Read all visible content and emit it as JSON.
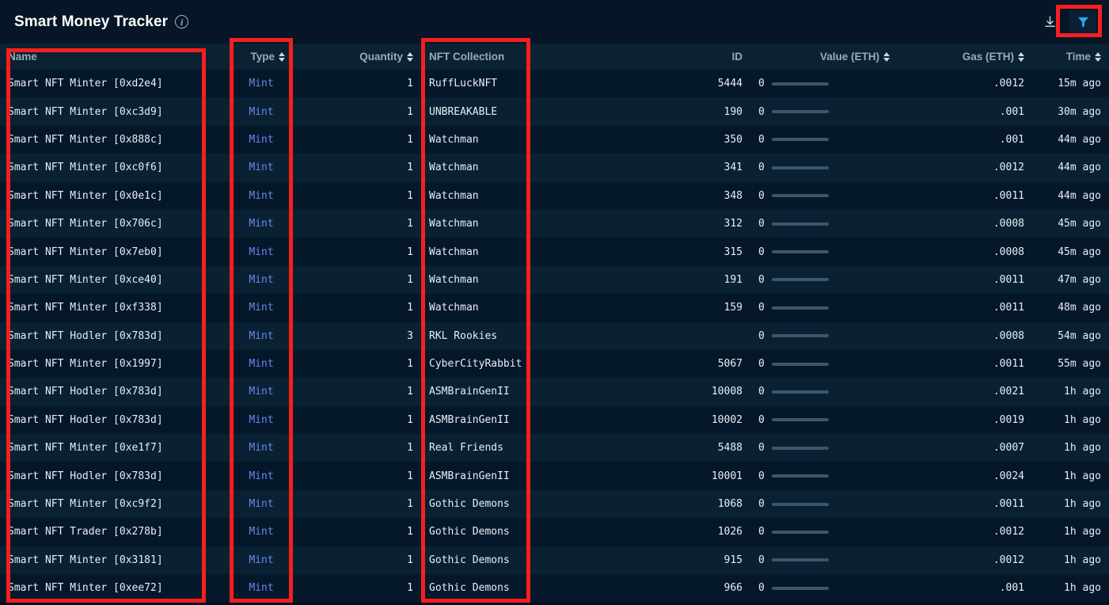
{
  "header": {
    "title": "Smart Money Tracker",
    "info_icon": "info-icon",
    "download_icon": "download-icon",
    "filter_icon": "filter-icon",
    "accent_color": "#2fa8e8",
    "highlight_color": "#f61f1f"
  },
  "table": {
    "columns": [
      {
        "key": "name",
        "label": "Name",
        "align": "left",
        "sortable": false
      },
      {
        "key": "type",
        "label": "Type",
        "align": "right",
        "sortable": true
      },
      {
        "key": "quantity",
        "label": "Quantity",
        "align": "right",
        "sortable": true
      },
      {
        "key": "nft",
        "label": "NFT Collection",
        "align": "left",
        "sortable": false
      },
      {
        "key": "id",
        "label": "ID",
        "align": "right",
        "sortable": false
      },
      {
        "key": "value",
        "label": "Value (ETH)",
        "align": "right",
        "sortable": true
      },
      {
        "key": "gas",
        "label": "Gas (ETH)",
        "align": "right",
        "sortable": true
      },
      {
        "key": "time",
        "label": "Time",
        "align": "right",
        "sortable": true
      }
    ],
    "rows": [
      {
        "name": "Smart NFT Minter [0xd2e4]",
        "type": "Mint",
        "quantity": "1",
        "nft": "RuffLuckNFT",
        "id": "5444",
        "value": "0",
        "gas": ".0012",
        "time": "15m ago"
      },
      {
        "name": "Smart NFT Minter [0xc3d9]",
        "type": "Mint",
        "quantity": "1",
        "nft": "UNBREAKABLE",
        "id": "190",
        "value": "0",
        "gas": ".001",
        "time": "30m ago"
      },
      {
        "name": "Smart NFT Minter [0x888c]",
        "type": "Mint",
        "quantity": "1",
        "nft": "Watchman",
        "id": "350",
        "value": "0",
        "gas": ".001",
        "time": "44m ago"
      },
      {
        "name": "Smart NFT Minter [0xc0f6]",
        "type": "Mint",
        "quantity": "1",
        "nft": "Watchman",
        "id": "341",
        "value": "0",
        "gas": ".0012",
        "time": "44m ago"
      },
      {
        "name": "Smart NFT Minter [0x0e1c]",
        "type": "Mint",
        "quantity": "1",
        "nft": "Watchman",
        "id": "348",
        "value": "0",
        "gas": ".0011",
        "time": "44m ago"
      },
      {
        "name": "Smart NFT Minter [0x706c]",
        "type": "Mint",
        "quantity": "1",
        "nft": "Watchman",
        "id": "312",
        "value": "0",
        "gas": ".0008",
        "time": "45m ago"
      },
      {
        "name": "Smart NFT Minter [0x7eb0]",
        "type": "Mint",
        "quantity": "1",
        "nft": "Watchman",
        "id": "315",
        "value": "0",
        "gas": ".0008",
        "time": "45m ago"
      },
      {
        "name": "Smart NFT Minter [0xce40]",
        "type": "Mint",
        "quantity": "1",
        "nft": "Watchman",
        "id": "191",
        "value": "0",
        "gas": ".0011",
        "time": "47m ago"
      },
      {
        "name": "Smart NFT Minter [0xf338]",
        "type": "Mint",
        "quantity": "1",
        "nft": "Watchman",
        "id": "159",
        "value": "0",
        "gas": ".0011",
        "time": "48m ago"
      },
      {
        "name": "Smart NFT Hodler [0x783d]",
        "type": "Mint",
        "quantity": "3",
        "nft": "RKL Rookies",
        "id": "",
        "value": "0",
        "gas": ".0008",
        "time": "54m ago"
      },
      {
        "name": "Smart NFT Minter [0x1997]",
        "type": "Mint",
        "quantity": "1",
        "nft": "CyberCityRabbit",
        "id": "5067",
        "value": "0",
        "gas": ".0011",
        "time": "55m ago"
      },
      {
        "name": "Smart NFT Hodler [0x783d]",
        "type": "Mint",
        "quantity": "1",
        "nft": "ASMBrainGenII",
        "id": "10008",
        "value": "0",
        "gas": ".0021",
        "time": "1h ago"
      },
      {
        "name": "Smart NFT Hodler [0x783d]",
        "type": "Mint",
        "quantity": "1",
        "nft": "ASMBrainGenII",
        "id": "10002",
        "value": "0",
        "gas": ".0019",
        "time": "1h ago"
      },
      {
        "name": "Smart NFT Minter [0xe1f7]",
        "type": "Mint",
        "quantity": "1",
        "nft": "Real Friends",
        "id": "5488",
        "value": "0",
        "gas": ".0007",
        "time": "1h ago"
      },
      {
        "name": "Smart NFT Hodler [0x783d]",
        "type": "Mint",
        "quantity": "1",
        "nft": "ASMBrainGenII",
        "id": "10001",
        "value": "0",
        "gas": ".0024",
        "time": "1h ago"
      },
      {
        "name": "Smart NFT Minter [0xc9f2]",
        "type": "Mint",
        "quantity": "1",
        "nft": "Gothic Demons",
        "id": "1068",
        "value": "0",
        "gas": ".0011",
        "time": "1h ago"
      },
      {
        "name": "Smart NFT Trader [0x278b]",
        "type": "Mint",
        "quantity": "1",
        "nft": "Gothic Demons",
        "id": "1026",
        "value": "0",
        "gas": ".0012",
        "time": "1h ago"
      },
      {
        "name": "Smart NFT Minter [0x3181]",
        "type": "Mint",
        "quantity": "1",
        "nft": "Gothic Demons",
        "id": "915",
        "value": "0",
        "gas": ".0012",
        "time": "1h ago"
      },
      {
        "name": "Smart NFT Minter [0xee72]",
        "type": "Mint",
        "quantity": "1",
        "nft": "Gothic Demons",
        "id": "966",
        "value": "0",
        "gas": ".001",
        "time": "1h ago"
      }
    ]
  },
  "annotations": [
    {
      "name": "name-column-highlight",
      "target": "Name column"
    },
    {
      "name": "type-column-highlight",
      "target": "Type column"
    },
    {
      "name": "nft-column-highlight",
      "target": "NFT Collection column"
    },
    {
      "name": "filter-button-highlight",
      "target": "Filter button"
    }
  ]
}
